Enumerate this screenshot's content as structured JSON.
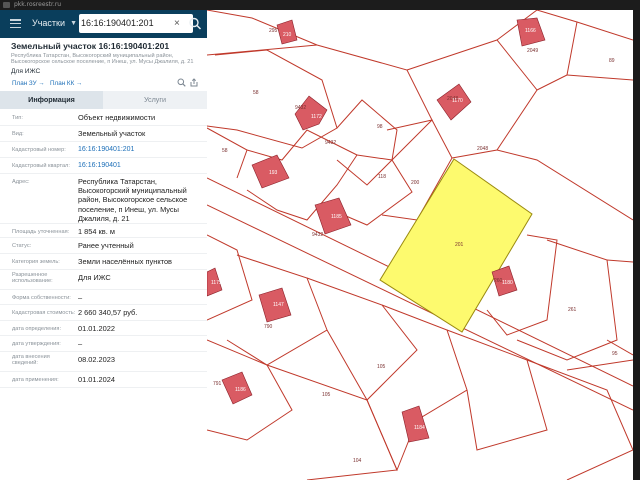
{
  "browser": {
    "url": "pkk.rosreestr.ru"
  },
  "search": {
    "layer": "Участки",
    "query": "16:16:190401:201"
  },
  "card": {
    "title": "Земельный участок 16:16:190401:201",
    "address_lines": [
      "Республика Татарстан, Высокогорский муниципальный район,",
      "Высокогорское сельское поселение, п Инеш, ул. Мусы Джалиля, д. 21"
    ],
    "purpose": "Для ИЖС",
    "plan_zu": "План ЗУ →",
    "plan_kk": "План КК →"
  },
  "tabs": {
    "info": "Информация",
    "services": "Услуги"
  },
  "properties": [
    {
      "label": [
        "Тип:"
      ],
      "value": [
        "Объект недвижимости"
      ]
    },
    {
      "label": [
        "Вид:"
      ],
      "value": [
        "Земельный участок"
      ]
    },
    {
      "label": [
        "Кадастровый номер:"
      ],
      "value": [
        "16:16:190401:201"
      ],
      "link": true
    },
    {
      "label": [
        "Кадастровый квартал:"
      ],
      "value": [
        "16:16:190401"
      ],
      "link": true
    },
    {
      "label": [
        "Адрес:"
      ],
      "value": [
        "Республика Татарстан,",
        "Высокогорский муниципальный",
        "район, Высокогорское сельское",
        "поселение, п Инеш, ул. Мусы",
        "Джалиля, д. 21"
      ]
    },
    {
      "label": [
        "Площадь уточненная:"
      ],
      "value": [
        "1 854 кв. м"
      ]
    },
    {
      "label": [
        "Статус:"
      ],
      "value": [
        "Ранее учтенный"
      ]
    },
    {
      "label": [
        "Категория земель:"
      ],
      "value": [
        "Земли населённых пунктов"
      ]
    },
    {
      "label": [
        "Разрешенное",
        "использование:"
      ],
      "value": [
        "Для ИЖС"
      ]
    },
    {
      "label": [
        "Форма собственности:"
      ],
      "value": [
        "–"
      ]
    },
    {
      "label": [
        "Кадастровая стоимость:"
      ],
      "value": [
        "2 660 340,57 руб."
      ]
    },
    {
      "label": [
        "дата определения:"
      ],
      "value": [
        "01.01.2022"
      ]
    },
    {
      "label": [
        "дата утверждения:"
      ],
      "value": [
        "–"
      ]
    },
    {
      "label": [
        "дата внесения",
        "сведений:"
      ],
      "value": [
        "08.02.2023"
      ]
    },
    {
      "label": [
        "дата применения:"
      ],
      "value": [
        "01.01.2024"
      ]
    }
  ],
  "map": {
    "parcel_labels": [
      "295",
      "9432",
      "9432",
      "58",
      "98",
      "200",
      "201",
      "2048",
      "2048",
      "2049",
      "89",
      "118",
      "9432",
      "58",
      "261",
      "260",
      "790",
      "791",
      "105",
      "105",
      "104",
      "95"
    ],
    "building_labels": [
      "210",
      "1172",
      "1166",
      "1170",
      "193",
      "1185",
      "1175",
      "1147",
      "1180",
      "1186",
      "1184"
    ],
    "colors": {
      "boundary": "#c0392b",
      "building_fill": "#d95b63",
      "selected_fill": "#fdfa6e",
      "selected_stroke": "#9a8a10"
    }
  }
}
